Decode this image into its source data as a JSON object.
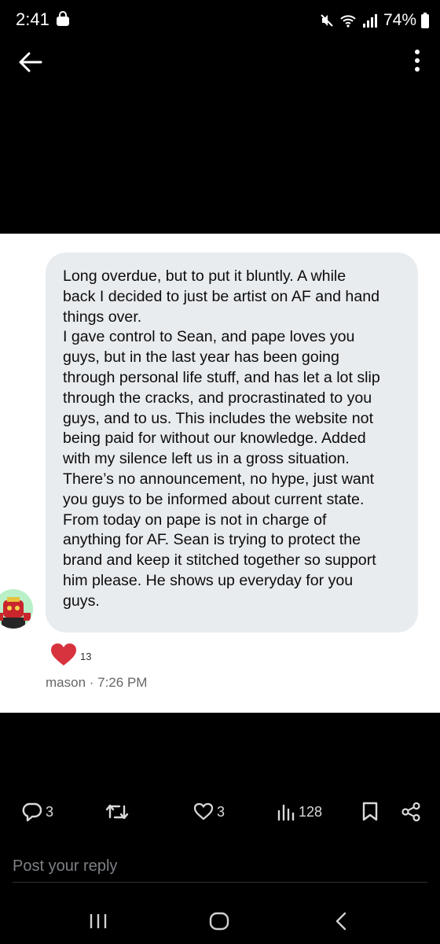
{
  "status_bar": {
    "time": "2:41",
    "battery": "74%"
  },
  "header": {
    "back_icon": "arrow-left-icon",
    "menu_icon": "more-vertical-icon"
  },
  "post": {
    "message": "Long overdue, but to put it bluntly. A while\nback I decided to just be artist on AF and hand\nthings over.\nI gave control to Sean, and pape loves you\nguys, but in the last year has been going\nthrough personal life stuff, and has let a lot slip\nthrough the cracks, and procrastinated to you\nguys, and to us. This includes the website not\nbeing paid for without our knowledge. Added\nwith my silence left us in a gross situation.\nThere’s no announcement, no hype, just want\nyou guys to be informed about current state.\nFrom today on pape is not in charge of\nanything for AF. Sean is trying to protect the\nbrand and keep it stitched together so support\nhim please. He shows up everyday for you\nguys.",
    "reaction_count": "13",
    "meta": "mason · 7:26 PM",
    "bubble_color": "#e9ecef",
    "heart_color": "#d6333f"
  },
  "actions": {
    "reply_count": "3",
    "like_count": "3",
    "view_count": "128"
  },
  "reply": {
    "placeholder": "Post your reply"
  }
}
